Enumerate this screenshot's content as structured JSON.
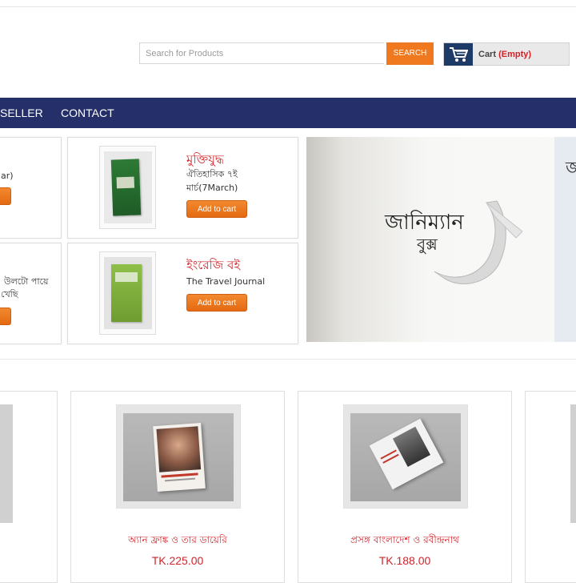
{
  "search": {
    "placeholder": "Search for Products",
    "button_label": "SEARCH"
  },
  "cart": {
    "label": "Cart",
    "status": "(Empty)"
  },
  "nav": {
    "items": [
      "SELLER",
      "CONTACT"
    ]
  },
  "featured": {
    "left_partial": [
      {
        "text": "ar)"
      },
      {
        "text_line1": "উলটো পায়ে",
        "text_line2": "খেছি"
      }
    ],
    "items": [
      {
        "category": "মুক্তিযুদ্ধ",
        "title_line1": "ঐতিহাসিক ৭ই",
        "title_line2": "মার্চ(7March)",
        "button": "Add to cart"
      },
      {
        "category": "ইংরেজি বই",
        "title_line1": "The Travel Journal",
        "button": "Add to cart"
      }
    ]
  },
  "banner": {
    "brand_line1": "জানিম্যান",
    "brand_line2": "বুক্স",
    "side_char": "জ"
  },
  "products": [
    {
      "name": "অ্যান ফ্রাঙ্ক ও তার ডায়েরি",
      "price": "TK.225.00"
    },
    {
      "name": "প্রসঙ্গ বাংলাদেশ ও রবীন্দ্রনাথ",
      "price": "TK.188.00"
    }
  ],
  "colors": {
    "accent": "#f0781e",
    "nav_bg": "#25306a",
    "brand_red": "#d2232a",
    "cart_icon_bg": "#1e3a66"
  },
  "icons": [
    "cart-icon"
  ]
}
